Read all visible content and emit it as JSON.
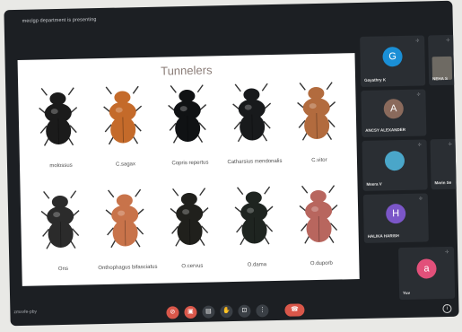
{
  "meeting": {
    "presenting_text": "meclgp department is presenting",
    "meeting_code": "zmxvfe-pby"
  },
  "slide": {
    "title": "Tunnelers",
    "beetles": [
      {
        "name": "molossus",
        "color": "#1b1b1b"
      },
      {
        "name": "C.sagax",
        "color": "#c46a2a"
      },
      {
        "name": "Copris repertus",
        "color": "#101214"
      },
      {
        "name": "Catharsius mendonalis",
        "color": "#181a1c"
      },
      {
        "name": "C.vitor",
        "color": "#b26b3e"
      },
      {
        "name": "Ons",
        "color": "#2b2b2b"
      },
      {
        "name": "Onthophagus bifasciatus",
        "color": "#c8734a"
      },
      {
        "name": "O.cervus",
        "color": "#20201c"
      },
      {
        "name": "O.dama",
        "color": "#1e2420"
      },
      {
        "name": "O.duporb",
        "color": "#b8665e"
      }
    ]
  },
  "participants": [
    {
      "initial": "G",
      "name": "Gayathry K",
      "color": "#1a8fd6"
    },
    {
      "initial": "",
      "name": "NEHA S",
      "color": "#2a2e33"
    },
    {
      "initial": "A",
      "name": "ANCSY ALEXANDER",
      "color": "#8a6a5c"
    },
    {
      "initial": "",
      "name": "Meera V",
      "color": "#4aa6c9"
    },
    {
      "initial": "",
      "name": "Marin Se",
      "color": "#2a2e33"
    },
    {
      "initial": "H",
      "name": "HALIKA HARISH",
      "color": "#7b56c8"
    },
    {
      "initial": "a",
      "name": "Yuv",
      "color": "#e2507a"
    }
  ],
  "controls": [
    {
      "icon": "mic-off-icon",
      "glyph": "⊘",
      "color": "#d9574a"
    },
    {
      "icon": "camera-off-icon",
      "glyph": "▣",
      "color": "#d9574a"
    },
    {
      "icon": "captions-icon",
      "glyph": "▤",
      "color": "#3a3f45"
    },
    {
      "icon": "raise-hand-icon",
      "glyph": "✋",
      "color": "#3a3f45"
    },
    {
      "icon": "present-icon",
      "glyph": "⊡",
      "color": "#3a3f45"
    },
    {
      "icon": "more-options-icon",
      "glyph": "⋮",
      "color": "#3a3f45"
    },
    {
      "icon": "end-call-icon",
      "glyph": "☎",
      "color": "#d9574a"
    }
  ]
}
